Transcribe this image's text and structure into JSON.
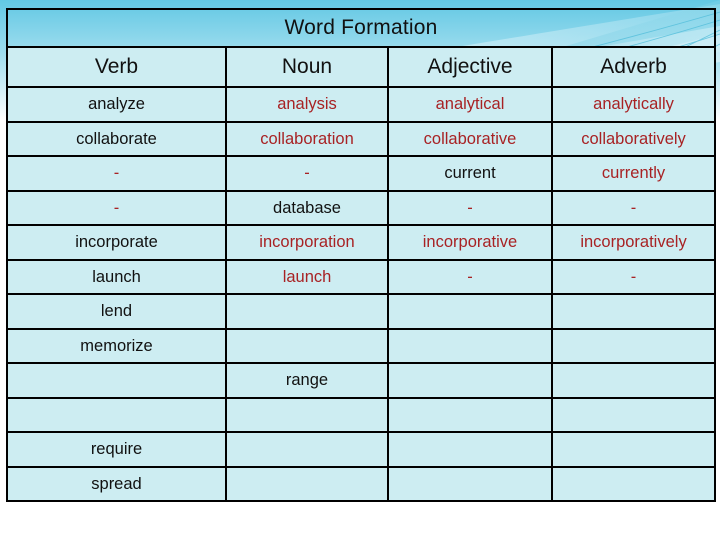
{
  "slide": {
    "title": "Word Formation",
    "theme_colors": {
      "cell_fill": "#CDEDF2",
      "border": "#000000",
      "given_text": "#111111",
      "answer_text": "#A82224",
      "bg_top": "#7FD3E8",
      "bg_accent": "#BFE9F2"
    }
  },
  "table": {
    "title": "Word Formation",
    "columns": [
      "Verb",
      "Noun",
      "Adjective",
      "Adverb"
    ],
    "rows": [
      {
        "verb": {
          "text": "analyze",
          "style": "given"
        },
        "noun": {
          "text": "analysis",
          "style": "answer"
        },
        "adjective": {
          "text": "analytical",
          "style": "answer"
        },
        "adverb": {
          "text": "analytically",
          "style": "answer"
        }
      },
      {
        "verb": {
          "text": "collaborate",
          "style": "given"
        },
        "noun": {
          "text": "collaboration",
          "style": "answer"
        },
        "adjective": {
          "text": "collaborative",
          "style": "answer"
        },
        "adverb": {
          "text": "collaboratively",
          "style": "answer"
        }
      },
      {
        "verb": {
          "text": "-",
          "style": "answer"
        },
        "noun": {
          "text": "-",
          "style": "answer"
        },
        "adjective": {
          "text": "current",
          "style": "given"
        },
        "adverb": {
          "text": "currently",
          "style": "answer"
        }
      },
      {
        "verb": {
          "text": "-",
          "style": "answer"
        },
        "noun": {
          "text": "database",
          "style": "given"
        },
        "adjective": {
          "text": "-",
          "style": "answer"
        },
        "adverb": {
          "text": "-",
          "style": "answer"
        }
      },
      {
        "verb": {
          "text": "incorporate",
          "style": "given"
        },
        "noun": {
          "text": "incorporation",
          "style": "answer"
        },
        "adjective": {
          "text": "incorporative",
          "style": "answer"
        },
        "adverb": {
          "text": "incorporatively",
          "style": "answer"
        }
      },
      {
        "verb": {
          "text": "launch",
          "style": "given"
        },
        "noun": {
          "text": "launch",
          "style": "answer"
        },
        "adjective": {
          "text": "-",
          "style": "answer"
        },
        "adverb": {
          "text": "-",
          "style": "answer"
        }
      },
      {
        "verb": {
          "text": "lend",
          "style": "given"
        },
        "noun": {
          "text": "",
          "style": "empty"
        },
        "adjective": {
          "text": "",
          "style": "empty"
        },
        "adverb": {
          "text": "",
          "style": "empty"
        }
      },
      {
        "verb": {
          "text": "memorize",
          "style": "given"
        },
        "noun": {
          "text": "",
          "style": "empty"
        },
        "adjective": {
          "text": "",
          "style": "empty"
        },
        "adverb": {
          "text": "",
          "style": "empty"
        }
      },
      {
        "verb": {
          "text": "",
          "style": "empty"
        },
        "noun": {
          "text": "range",
          "style": "given"
        },
        "adjective": {
          "text": "",
          "style": "empty"
        },
        "adverb": {
          "text": "",
          "style": "empty"
        }
      },
      {
        "verb": {
          "text": "",
          "style": "empty"
        },
        "noun": {
          "text": "",
          "style": "empty"
        },
        "adjective": {
          "text": "",
          "style": "empty"
        },
        "adverb": {
          "text": "",
          "style": "empty"
        }
      },
      {
        "verb": {
          "text": "require",
          "style": "given"
        },
        "noun": {
          "text": "",
          "style": "empty"
        },
        "adjective": {
          "text": "",
          "style": "empty"
        },
        "adverb": {
          "text": "",
          "style": "empty"
        }
      },
      {
        "verb": {
          "text": "spread",
          "style": "given"
        },
        "noun": {
          "text": "",
          "style": "empty"
        },
        "adjective": {
          "text": "",
          "style": "empty"
        },
        "adverb": {
          "text": "",
          "style": "empty"
        }
      }
    ]
  }
}
